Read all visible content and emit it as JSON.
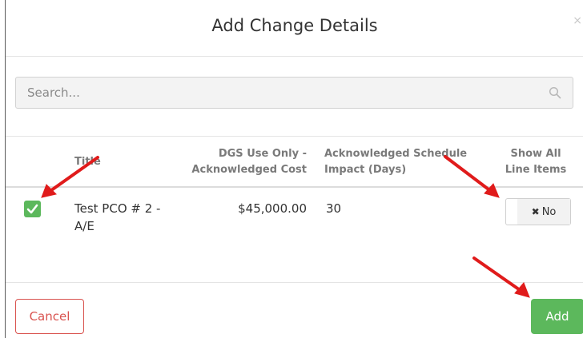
{
  "modal": {
    "title": "Add Change Details",
    "close_glyph": "×"
  },
  "search": {
    "placeholder": "Search...",
    "value": "",
    "icon": "search-icon"
  },
  "table": {
    "columns": [
      {
        "key": "title",
        "label": "Title"
      },
      {
        "key": "cost",
        "label": "DGS Use Only - Acknowledged Cost"
      },
      {
        "key": "schedule",
        "label": "Acknowledged Schedule Impact (Days)"
      },
      {
        "key": "lines",
        "label": "Show All Line Items"
      }
    ],
    "rows": [
      {
        "checked": true,
        "title": "Test PCO # 2 - A/E",
        "cost": "$45,000.00",
        "schedule": "30",
        "toggle_label": "No",
        "toggle_icon": "close-icon"
      }
    ]
  },
  "footer": {
    "cancel_label": "Cancel",
    "add_label": "Add"
  },
  "colors": {
    "success": "#5cb85c",
    "danger": "#d9534f",
    "annotation_arrow": "#e01b1b"
  }
}
